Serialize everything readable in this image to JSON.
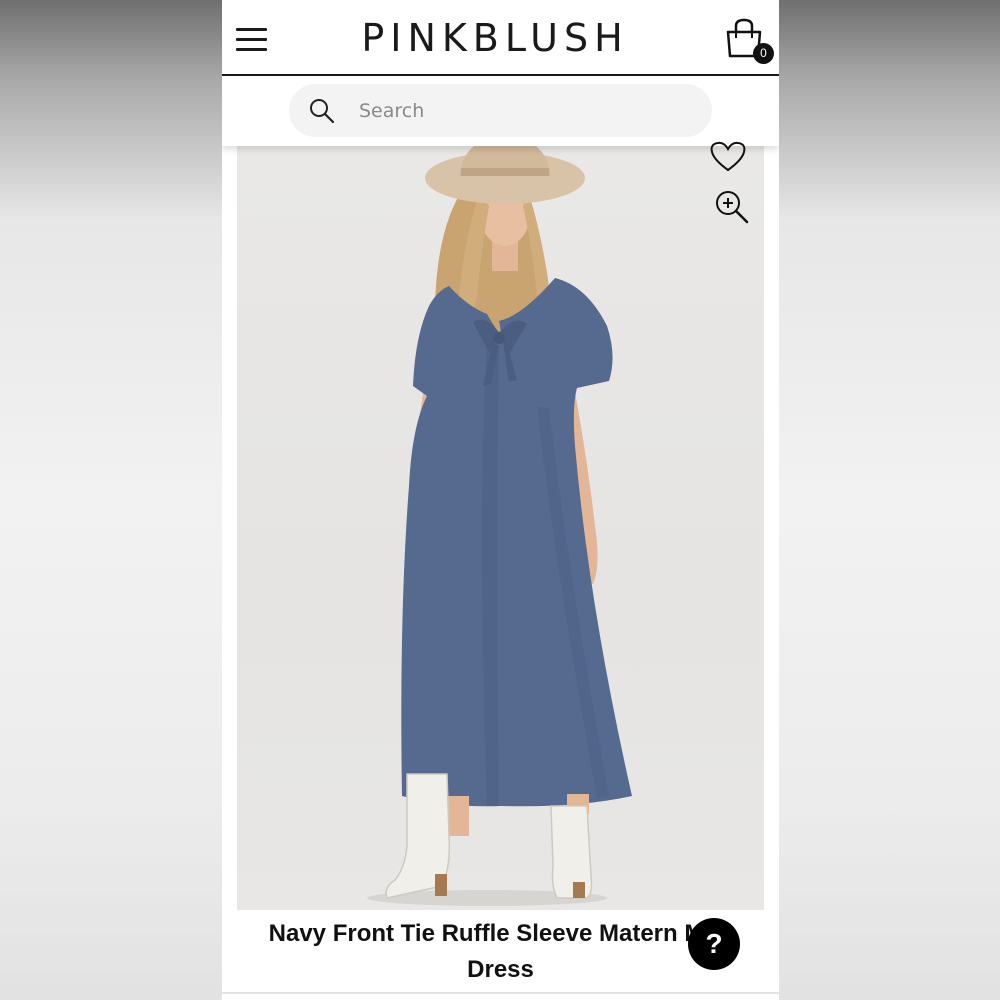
{
  "header": {
    "logo": "PINKBLUSH",
    "cart_count": "0",
    "icons": {
      "menu": "hamburger-menu-icon",
      "cart": "shopping-bag-icon"
    }
  },
  "search": {
    "placeholder": "Search",
    "icon": "search-icon"
  },
  "product": {
    "title": "Navy Front Tie Ruffle Sleeve Matern Midi Dress",
    "image_alt": "Model wearing navy maternity midi dress",
    "dress_color": "#56698f"
  },
  "actions": {
    "wishlist_icon": "heart-icon",
    "zoom_icon": "zoom-in-icon",
    "help_label": "?"
  }
}
